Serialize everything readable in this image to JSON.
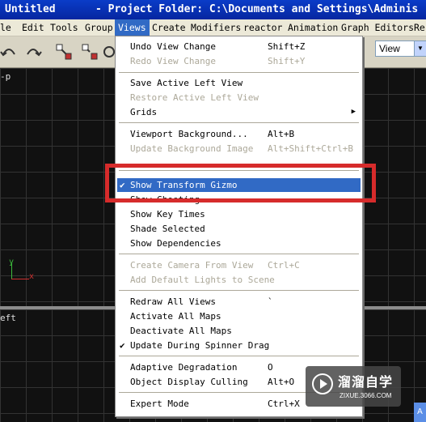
{
  "window": {
    "title_left": "Untitled",
    "title_right": "- Project Folder: C:\\Documents and Settings\\Adminis"
  },
  "menubar": {
    "items": [
      {
        "label": "le"
      },
      {
        "label": "Edit"
      },
      {
        "label": "Tools"
      },
      {
        "label": "Group"
      },
      {
        "label": "Views"
      },
      {
        "label": "Create"
      },
      {
        "label": "Modifiers"
      },
      {
        "label": "reactor"
      },
      {
        "label": "Animation"
      },
      {
        "label": "Graph Editors"
      },
      {
        "label": "Re"
      }
    ],
    "active": "Views"
  },
  "toolbar": {
    "view_combo": "View"
  },
  "viewports": {
    "top_label": "-p",
    "bottom_label": "eft",
    "axis_y": "y",
    "axis_x": "x"
  },
  "views_menu": {
    "items": [
      {
        "label": "Undo View Change",
        "shortcut": "Shift+Z",
        "enabled": true
      },
      {
        "label": "Redo View Change",
        "shortcut": "Shift+Y",
        "enabled": false
      },
      {
        "label": "Save Active Left View",
        "shortcut": "",
        "enabled": true
      },
      {
        "label": "Restore Active Left View",
        "shortcut": "",
        "enabled": false
      },
      {
        "label": "Grids",
        "shortcut": "",
        "enabled": true,
        "submenu": true
      },
      {
        "label": "Viewport Background...",
        "shortcut": "Alt+B",
        "enabled": true
      },
      {
        "label": "Update Background Image",
        "shortcut": "Alt+Shift+Ctrl+B",
        "enabled": false
      },
      {
        "label": "Show Transform Gizmo",
        "shortcut": "",
        "enabled": true,
        "checked": true,
        "highlighted": true
      },
      {
        "label": "Show Ghosting",
        "shortcut": "",
        "enabled": true
      },
      {
        "label": "Show Key Times",
        "shortcut": "",
        "enabled": true
      },
      {
        "label": "Shade Selected",
        "shortcut": "",
        "enabled": true
      },
      {
        "label": "Show Dependencies",
        "shortcut": "",
        "enabled": true
      },
      {
        "label": "Create Camera From View",
        "shortcut": "Ctrl+C",
        "enabled": false
      },
      {
        "label": "Add Default Lights to Scene",
        "shortcut": "",
        "enabled": false
      },
      {
        "label": "Redraw All Views",
        "shortcut": "`",
        "enabled": true
      },
      {
        "label": "Activate All Maps",
        "shortcut": "",
        "enabled": true
      },
      {
        "label": "Deactivate All Maps",
        "shortcut": "",
        "enabled": true
      },
      {
        "label": "Update During Spinner Drag",
        "shortcut": "",
        "enabled": true,
        "checked": true
      },
      {
        "label": "Adaptive Degradation",
        "shortcut": "O",
        "enabled": true
      },
      {
        "label": "Object Display Culling",
        "shortcut": "Alt+O",
        "enabled": true
      },
      {
        "label": "Expert Mode",
        "shortcut": "Ctrl+X",
        "enabled": true
      }
    ]
  },
  "watermark": {
    "text_cn": "溜溜自学",
    "url": "ZIXUE.3066.COM"
  },
  "corner_badge": "A",
  "colors": {
    "title_bar": "#0a3cc8",
    "menu_highlight": "#316ac5",
    "annotation_red": "#d62b2b",
    "disabled_text": "#aca899"
  },
  "icons": {
    "checkmark": "check-icon",
    "submenu": "chevron-right-icon",
    "combo_arrow": "chevron-down-icon"
  }
}
